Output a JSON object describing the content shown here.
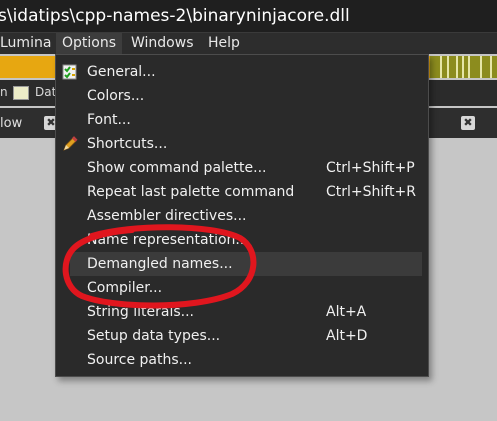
{
  "window": {
    "title": "s\\idatips\\cpp-names-2\\binaryninjacore.dll"
  },
  "menubar": {
    "items": [
      {
        "label": "Lumina"
      },
      {
        "label": "Options"
      },
      {
        "label": "Windows"
      },
      {
        "label": "Help"
      }
    ]
  },
  "legend": {
    "items": [
      {
        "label": "n"
      },
      {
        "label": "Dat"
      }
    ]
  },
  "panel": {
    "label": "low",
    "close_glyph": "✖"
  },
  "options_menu": {
    "items": [
      {
        "label": "General...",
        "shortcut": "",
        "icon": "checklist-icon"
      },
      {
        "label": "Colors...",
        "shortcut": ""
      },
      {
        "label": "Font...",
        "shortcut": ""
      },
      {
        "label": "Shortcuts...",
        "shortcut": "",
        "icon": "pen-icon"
      },
      {
        "label": "Show command palette...",
        "shortcut": "Ctrl+Shift+P"
      },
      {
        "label": "Repeat last palette command",
        "shortcut": "Ctrl+Shift+R"
      },
      {
        "label": "Assembler directives...",
        "shortcut": ""
      },
      {
        "label": "Name representation...",
        "shortcut": ""
      },
      {
        "label": "Demangled names...",
        "shortcut": ""
      },
      {
        "label": "Compiler...",
        "shortcut": ""
      },
      {
        "label": "String literals...",
        "shortcut": "Alt+A"
      },
      {
        "label": "Setup data types...",
        "shortcut": "Alt+D"
      },
      {
        "label": "Source paths...",
        "shortcut": ""
      }
    ],
    "highlighted_item": "Demangled names..."
  },
  "colors": {
    "annotation_circle": "#e0161e",
    "nav_orange": "#e7a711",
    "nav_olive": "#8c8c1e"
  }
}
